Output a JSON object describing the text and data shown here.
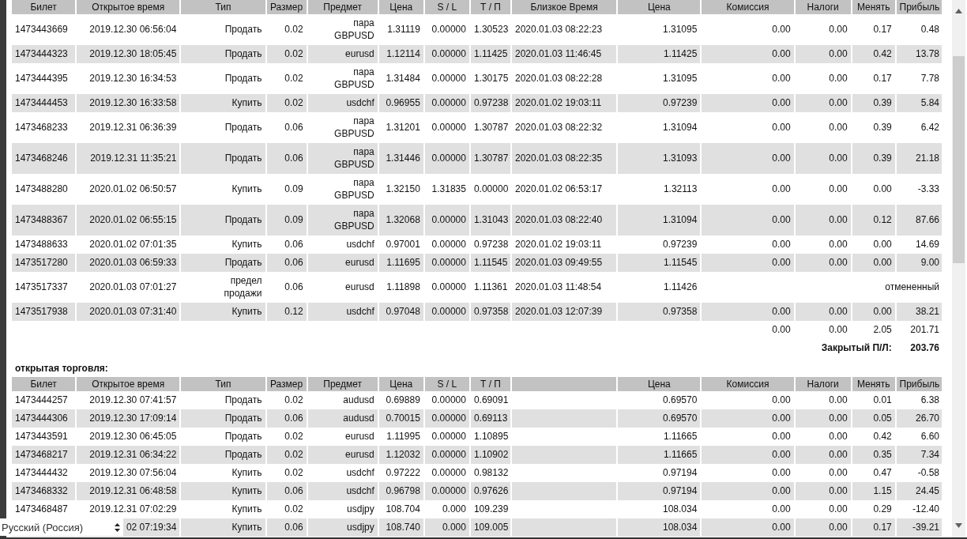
{
  "closed_trades": {
    "columns": [
      {
        "label": "Билет"
      },
      {
        "label": "Открытое время"
      },
      {
        "label": "Тип"
      },
      {
        "label": "Размер"
      },
      {
        "label": "Предмет"
      },
      {
        "label": "Цена"
      },
      {
        "label": "S / L"
      },
      {
        "label": "Т / П"
      },
      {
        "label": "Близкое Время"
      },
      {
        "label": "Цена"
      },
      {
        "label": "Комиссия"
      },
      {
        "label": "Налоги"
      },
      {
        "label": "Менять"
      },
      {
        "label": "Прибыль"
      }
    ],
    "rows": [
      {
        "cells": [
          "1473443669",
          "2019.12.30 06:56:04",
          "Продать",
          "0.02",
          "пара GBPUSD",
          "1.31119",
          "0.00000",
          "1.30523",
          "2020.01.03 08:22:23",
          "1.31095",
          "0.00",
          "0.00",
          "0.17",
          "0.48"
        ]
      },
      {
        "cells": [
          "1473444323",
          "2019.12.30 18:05:45",
          "Продать",
          "0.02",
          "eurusd",
          "1.12114",
          "0.00000",
          "1.11425",
          "2020.01.03 11:46:45",
          "1.11425",
          "0.00",
          "0.00",
          "0.42",
          "13.78"
        ]
      },
      {
        "cells": [
          "1473444395",
          "2019.12.30 16:34:53",
          "Продать",
          "0.02",
          "пара GBPUSD",
          "1.31484",
          "0.00000",
          "1.30175",
          "2020.01.03 08:22:28",
          "1.31095",
          "0.00",
          "0.00",
          "0.17",
          "7.78"
        ]
      },
      {
        "cells": [
          "1473444453",
          "2019.12.30 16:33:58",
          "Купить",
          "0.02",
          "usdchf",
          "0.96955",
          "0.00000",
          "0.97238",
          "2020.01.02 19:03:11",
          "0.97239",
          "0.00",
          "0.00",
          "0.39",
          "5.84"
        ]
      },
      {
        "cells": [
          "1473468233",
          "2019.12.31 06:36:39",
          "Продать",
          "0.06",
          "пара GBPUSD",
          "1.31201",
          "0.00000",
          "1.30787",
          "2020.01.03 08:22:32",
          "1.31094",
          "0.00",
          "0.00",
          "0.39",
          "6.42"
        ]
      },
      {
        "cells": [
          "1473468246",
          "2019.12.31 11:35:21",
          "Продать",
          "0.06",
          "пара GBPUSD",
          "1.31446",
          "0.00000",
          "1.30787",
          "2020.01.03 08:22:35",
          "1.31093",
          "0.00",
          "0.00",
          "0.39",
          "21.18"
        ]
      },
      {
        "cells": [
          "1473488280",
          "2020.01.02 06:50:57",
          "Купить",
          "0.09",
          "пара GBPUSD",
          "1.32150",
          "1.31835",
          "0.00000",
          "2020.01.02 06:53:17",
          "1.32113",
          "0.00",
          "0.00",
          "0.00",
          "-3.33"
        ]
      },
      {
        "cells": [
          "1473488367",
          "2020.01.02 06:55:15",
          "Продать",
          "0.09",
          "пара GBPUSD",
          "1.32068",
          "0.00000",
          "1.31043",
          "2020.01.03 08:22:40",
          "1.31094",
          "0.00",
          "0.00",
          "0.12",
          "87.66"
        ]
      },
      {
        "cells": [
          "1473488633",
          "2020.01.02 07:01:35",
          "Купить",
          "0.06",
          "usdchf",
          "0.97001",
          "0.00000",
          "0.97238",
          "2020.01.02 19:03:11",
          "0.97239",
          "0.00",
          "0.00",
          "0.00",
          "14.69"
        ]
      },
      {
        "cells": [
          "1473517280",
          "2020.01.03 06:59:33",
          "Продать",
          "0.06",
          "eurusd",
          "1.11695",
          "0.00000",
          "1.11545",
          "2020.01.03 09:49:55",
          "1.11545",
          "0.00",
          "0.00",
          "0.00",
          "9.00"
        ]
      },
      {
        "cells": [
          "1473517337",
          "2020.01.03 07:01:27",
          "предел продажи",
          "0.06",
          "eurusd",
          "1.11898",
          "0.00000",
          "1.11361",
          "2020.01.03 11:48:54",
          "1.11426"
        ],
        "status": "отмененный"
      },
      {
        "cells": [
          "1473517938",
          "2020.01.03 07:31:40",
          "Купить",
          "0.12",
          "usdchf",
          "0.97048",
          "0.00000",
          "0.97358",
          "2020.01.03 12:07:39",
          "0.97358",
          "0.00",
          "0.00",
          "0.00",
          "38.21"
        ]
      }
    ],
    "totals": [
      "0.00",
      "0.00",
      "2.05",
      "201.71"
    ],
    "closed_pl": {
      "label": "Закрытый П/Л:",
      "value": "203.76"
    }
  },
  "open_trades": {
    "title": "открытая торговля:",
    "columns": [
      {
        "label": "Билет"
      },
      {
        "label": "Открытое время"
      },
      {
        "label": "Тип"
      },
      {
        "label": "Размер"
      },
      {
        "label": "Предмет"
      },
      {
        "label": "Цена"
      },
      {
        "label": "S / L"
      },
      {
        "label": "Т / П"
      },
      {
        "kind": "blank"
      },
      {
        "label": "Цена"
      },
      {
        "label": "Комиссия"
      },
      {
        "label": "Налоги"
      },
      {
        "label": "Менять"
      },
      {
        "label": "Прибыль"
      }
    ],
    "rows": [
      {
        "cells": [
          "1473444257",
          "2019.12.30 07:41:57",
          "Продать",
          "0.02",
          "audusd",
          "0.69889",
          "0.00000",
          "0.69091",
          "",
          "0.69570",
          "0.00",
          "0.00",
          "0.01",
          "6.38"
        ]
      },
      {
        "cells": [
          "1473444306",
          "2019.12.30 17:09:14",
          "Продать",
          "0.06",
          "audusd",
          "0.70015",
          "0.00000",
          "0.69113",
          "",
          "0.69570",
          "0.00",
          "0.00",
          "0.05",
          "26.70"
        ]
      },
      {
        "cells": [
          "1473443591",
          "2019.12.30 06:45:05",
          "Продать",
          "0.02",
          "eurusd",
          "1.11995",
          "0.00000",
          "1.10895",
          "",
          "1.11665",
          "0.00",
          "0.00",
          "0.42",
          "6.60"
        ]
      },
      {
        "cells": [
          "1473468217",
          "2019.12.31 06:34:22",
          "Продать",
          "0.02",
          "eurusd",
          "1.12032",
          "0.00000",
          "1.10902",
          "",
          "1.11665",
          "0.00",
          "0.00",
          "0.35",
          "7.34"
        ]
      },
      {
        "cells": [
          "1473444432",
          "2019.12.30 07:56:04",
          "Купить",
          "0.02",
          "usdchf",
          "0.97222",
          "0.00000",
          "0.98132",
          "",
          "0.97194",
          "0.00",
          "0.00",
          "0.47",
          "-0.58"
        ]
      },
      {
        "cells": [
          "1473468332",
          "2019.12.31 06:48:58",
          "Купить",
          "0.06",
          "usdchf",
          "0.96798",
          "0.00000",
          "0.97626",
          "",
          "0.97194",
          "0.00",
          "0.00",
          "1.15",
          "24.45"
        ]
      },
      {
        "cells": [
          "1473468487",
          "2019.12.31 07:02:29",
          "Купить",
          "0.02",
          "usdjpy",
          "108.704",
          "0.000",
          "109.239",
          "",
          "108.034",
          "0.00",
          "0.00",
          "0.29",
          "-12.40"
        ]
      },
      {
        "cells": [
          "",
          "02 07:19:34",
          "Купить",
          "0.06",
          "usdjpy",
          "108.740",
          "0.000",
          "109.005",
          "",
          "108.034",
          "0.00",
          "0.00",
          "0.17",
          "-39.21"
        ]
      }
    ]
  },
  "language_select": {
    "value": "Русский (Россия)"
  }
}
